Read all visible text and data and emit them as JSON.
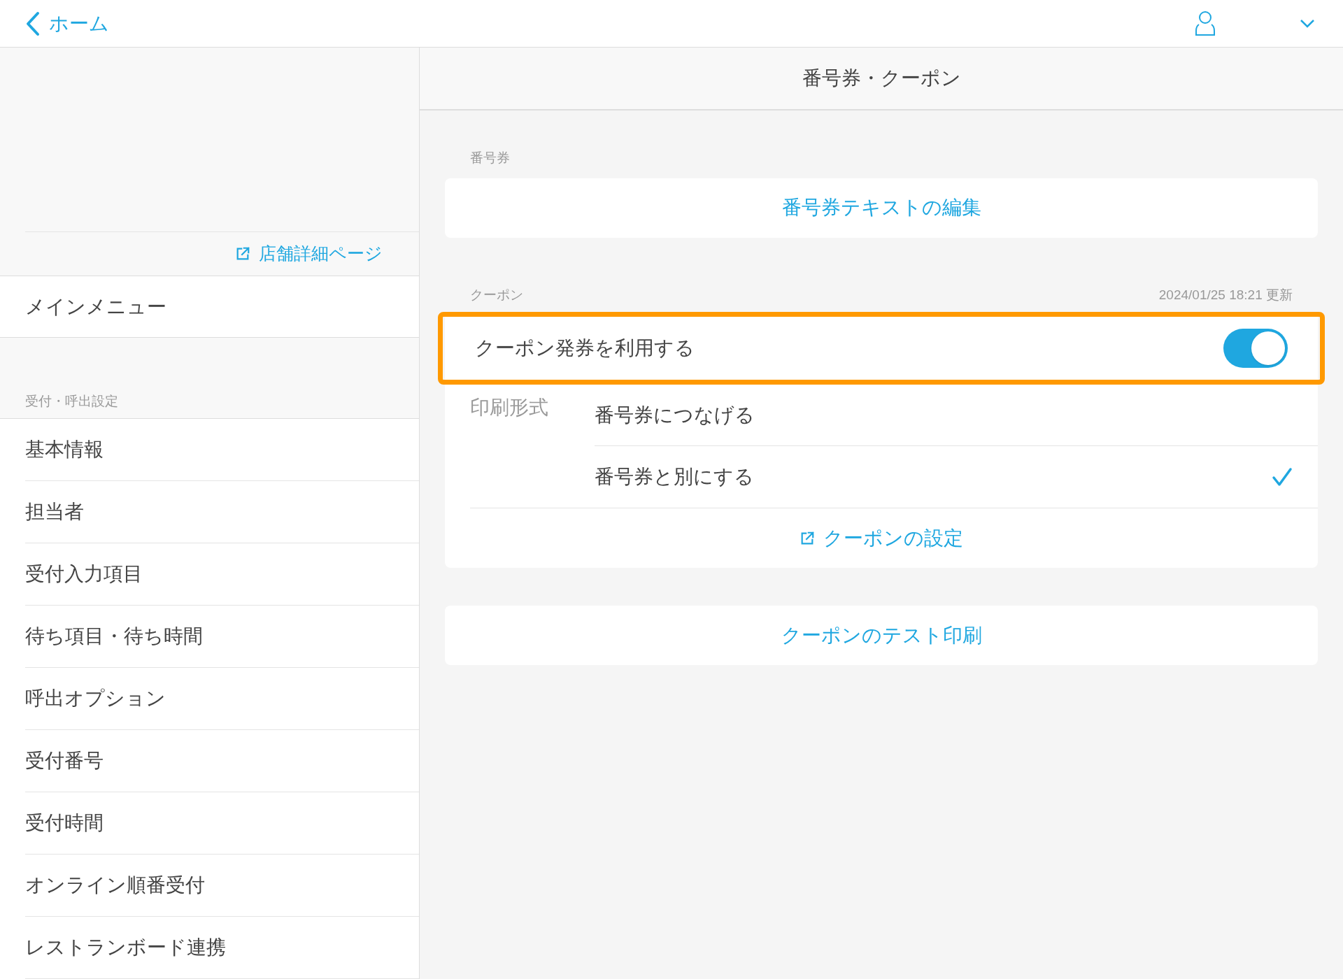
{
  "top_bar": {
    "back_label": "ホーム"
  },
  "sidebar": {
    "store_link": "店舗詳細ページ",
    "main_menu": "メインメニュー",
    "section_label": "受付・呼出設定",
    "items": [
      {
        "label": "基本情報"
      },
      {
        "label": "担当者"
      },
      {
        "label": "受付入力項目"
      },
      {
        "label": "待ち項目・待ち時間"
      },
      {
        "label": "呼出オプション"
      },
      {
        "label": "受付番号"
      },
      {
        "label": "受付時間"
      },
      {
        "label": "オンライン順番受付"
      },
      {
        "label": "レストランボード連携"
      }
    ]
  },
  "page": {
    "title": "番号券・クーポン",
    "ticket_section": {
      "label": "番号券",
      "edit_button": "番号券テキストの編集"
    },
    "coupon_section": {
      "label": "クーポン",
      "updated": "2024/01/25 18:21 更新",
      "toggle_label": "クーポン発券を利用する",
      "toggle_on": true,
      "highlighted": true,
      "print_format_label": "印刷形式",
      "options": [
        {
          "label": "番号券につなげる",
          "selected": false
        },
        {
          "label": "番号券と別にする",
          "selected": true
        }
      ],
      "settings_link": "クーポンの設定"
    },
    "test_print_button": "クーポンのテスト印刷"
  }
}
